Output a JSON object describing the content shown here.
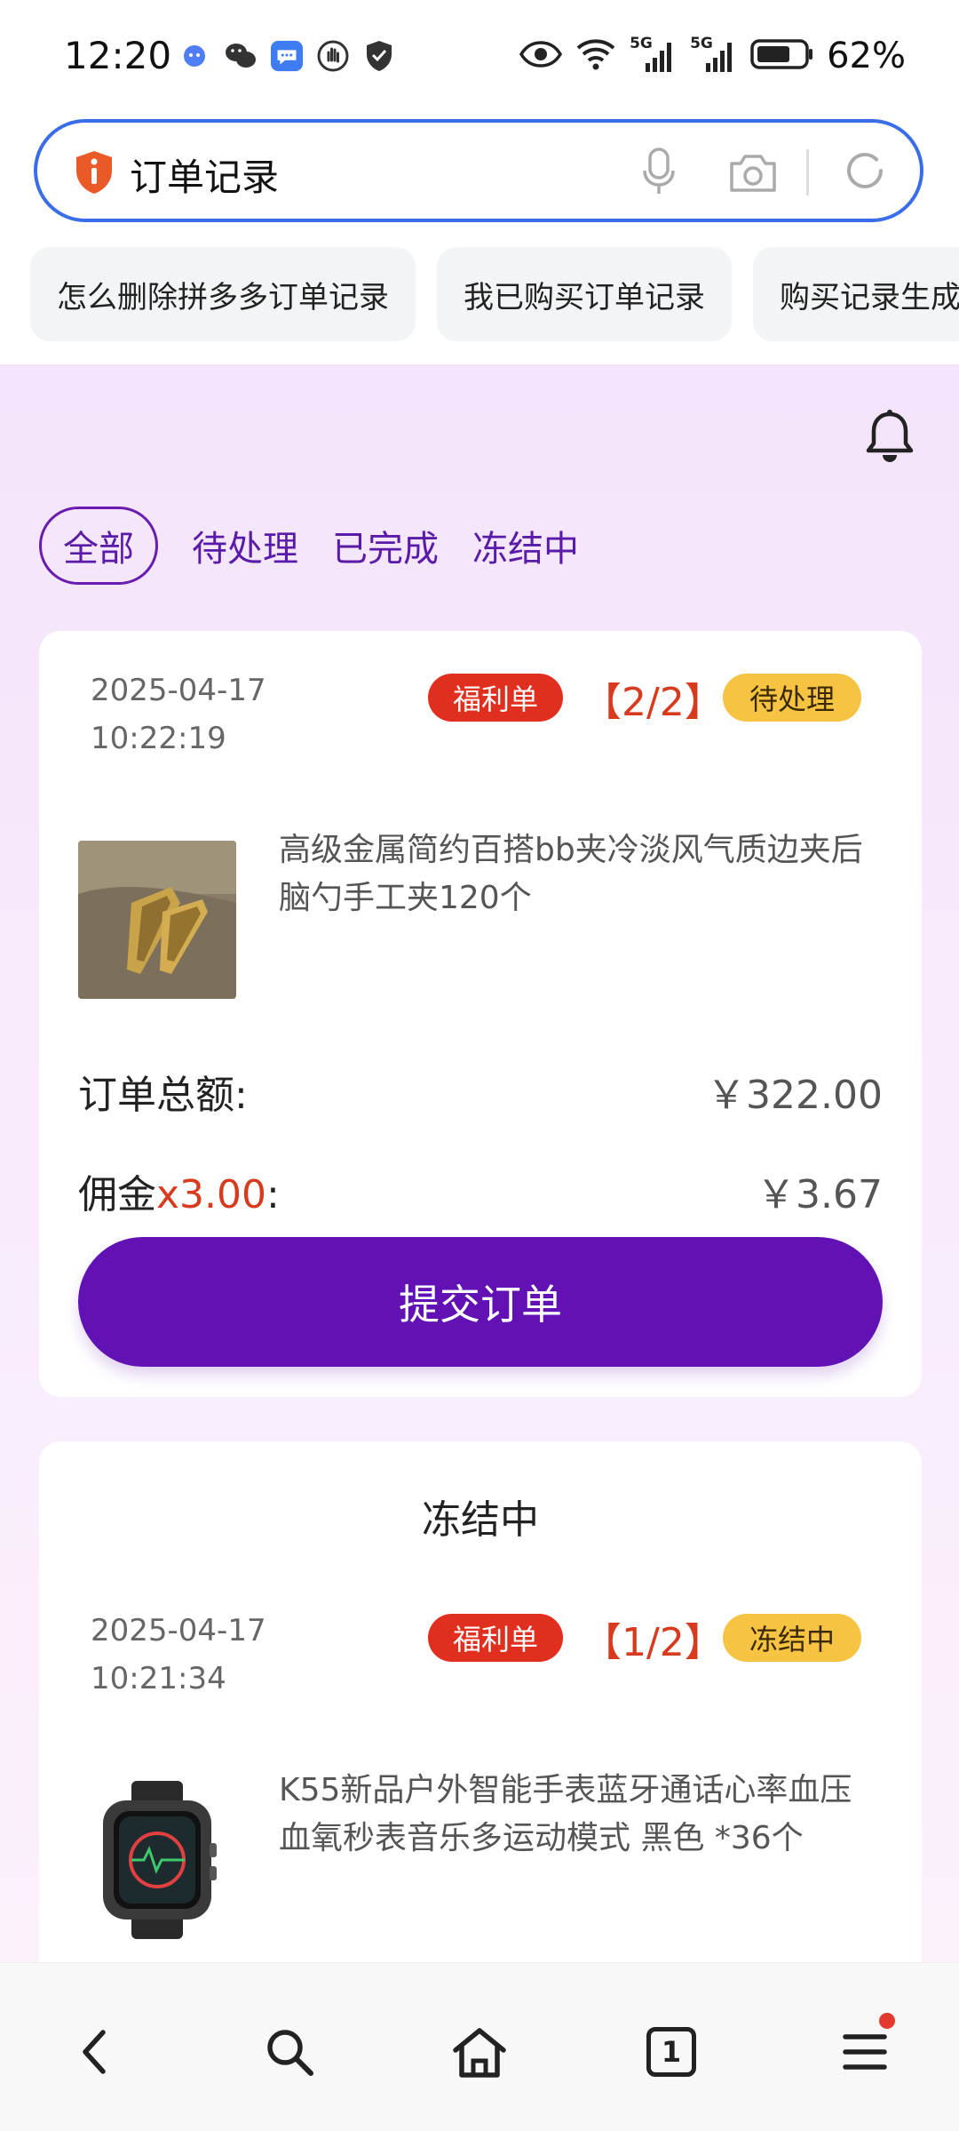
{
  "status_bar": {
    "time": "12:20",
    "battery": "62%",
    "signal_label_1": "5G",
    "signal_label_2": "5G",
    "icons_left": [
      "chat-bubble-icon",
      "wechat-icon",
      "message-icon",
      "hand-icon",
      "shield-check-icon"
    ],
    "icons_right": [
      "eye-icon",
      "wifi-icon",
      "signal-icon",
      "signal-icon",
      "battery-icon"
    ]
  },
  "search": {
    "query": "订单记录",
    "suggestions": [
      "怎么删除拼多多订单记录",
      "我已购买订单记录",
      "购买记录生成"
    ]
  },
  "tabs": [
    "全部",
    "待处理",
    "已完成",
    "冻结中"
  ],
  "orders": [
    {
      "date": "2025-04-17",
      "time": "10:22:19",
      "type_tag": "福利单",
      "count": "【2/2】",
      "status": "待处理",
      "product": "高级金属简约百搭bb夹冷淡风气质边夹后脑勺手工夹120个",
      "total_label": "订单总额:",
      "total_value": "￥322.00",
      "commission_label": "佣金",
      "commission_rate": "x3.00",
      "commission_colon": ":",
      "commission_value": "￥3.67",
      "button": "提交订单"
    },
    {
      "section_title": "冻结中",
      "date": "2025-04-17",
      "time": "10:21:34",
      "type_tag": "福利单",
      "count": "【1/2】",
      "status": "冻结中",
      "product": "K55新品户外智能手表蓝牙通话心率血压血氧秒表音乐多运动模式 黑色 *36个"
    }
  ],
  "bottom_nav": {
    "items": [
      "back-icon",
      "search-icon",
      "home-icon",
      "tabs-icon",
      "menu-icon"
    ],
    "tab_count": "1"
  },
  "colors": {
    "accent": "#6212b4",
    "search_border": "#3a6ee8",
    "tag_red": "#e02f1e",
    "tag_yellow": "#f6c343"
  }
}
